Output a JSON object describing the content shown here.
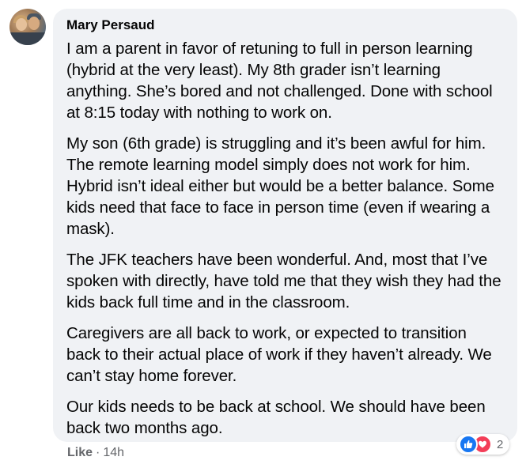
{
  "comment": {
    "author": "Mary Persaud",
    "paragraphs": [
      "I am a parent in favor of retuning to full in person learning (hybrid at the very least). My 8th grader isn’t learning anything. She’s bored and not challenged. Done with school at 8:15 today with nothing to work on.",
      "My son (6th grade) is struggling and it’s been awful for him. The remote learning model simply does not work for him. Hybrid isn’t ideal either but would be a better balance. Some kids need that face to face in person time (even if wearing a mask).",
      "The JFK teachers have been wonderful. And, most that I’ve spoken with directly, have told me that they wish they had the kids back full time and in the classroom.",
      "Caregivers are all back to work, or expected to transition back to their actual place of work if they haven’t already. We can’t stay home forever.",
      "Our kids needs to be back at school. We should have been back two months ago."
    ]
  },
  "actions": {
    "like_label": "Like",
    "separator": "·",
    "timestamp": "14h"
  },
  "reactions": {
    "icons": [
      "like-icon",
      "love-icon"
    ],
    "count": "2",
    "colors": {
      "like": "#1877f2",
      "love": "#f33e58"
    }
  }
}
